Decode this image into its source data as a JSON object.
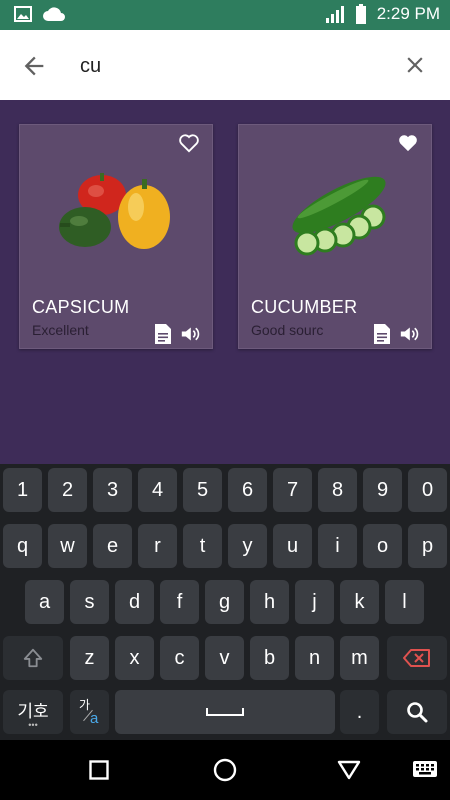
{
  "status_bar": {
    "time": "2:29 PM",
    "icons": [
      "image-icon",
      "cloud-icon",
      "signal-icon",
      "battery-icon"
    ]
  },
  "search": {
    "query": "cu",
    "back_icon": "arrow-left-icon",
    "clear_icon": "close-icon"
  },
  "results": [
    {
      "title": "CAPSICUM",
      "subtitle": "Excellent",
      "favorite": false,
      "image": "capsicum-image"
    },
    {
      "title": "CUCUMBER",
      "subtitle": "Good sourc",
      "favorite": true,
      "image": "cucumber-image"
    }
  ],
  "keyboard": {
    "row_numbers": [
      "1",
      "2",
      "3",
      "4",
      "5",
      "6",
      "7",
      "8",
      "9",
      "0"
    ],
    "row_1": [
      "q",
      "w",
      "e",
      "r",
      "t",
      "y",
      "u",
      "i",
      "o",
      "p"
    ],
    "row_2": [
      "a",
      "s",
      "d",
      "f",
      "g",
      "h",
      "j",
      "k",
      "l"
    ],
    "row_3": [
      "z",
      "x",
      "c",
      "v",
      "b",
      "n",
      "m"
    ],
    "symbols_label": "기호",
    "lang_label_top": "가",
    "lang_label_bottom": "a",
    "period_label": "."
  },
  "colors": {
    "status_bar": "#2e7d5e",
    "results_bg": "#3e2c58",
    "card_bg": "#5d4a6c",
    "keyboard_bg": "#1f2124",
    "key_bg": "#3a3d42",
    "backspace_accent": "#e0524f"
  }
}
